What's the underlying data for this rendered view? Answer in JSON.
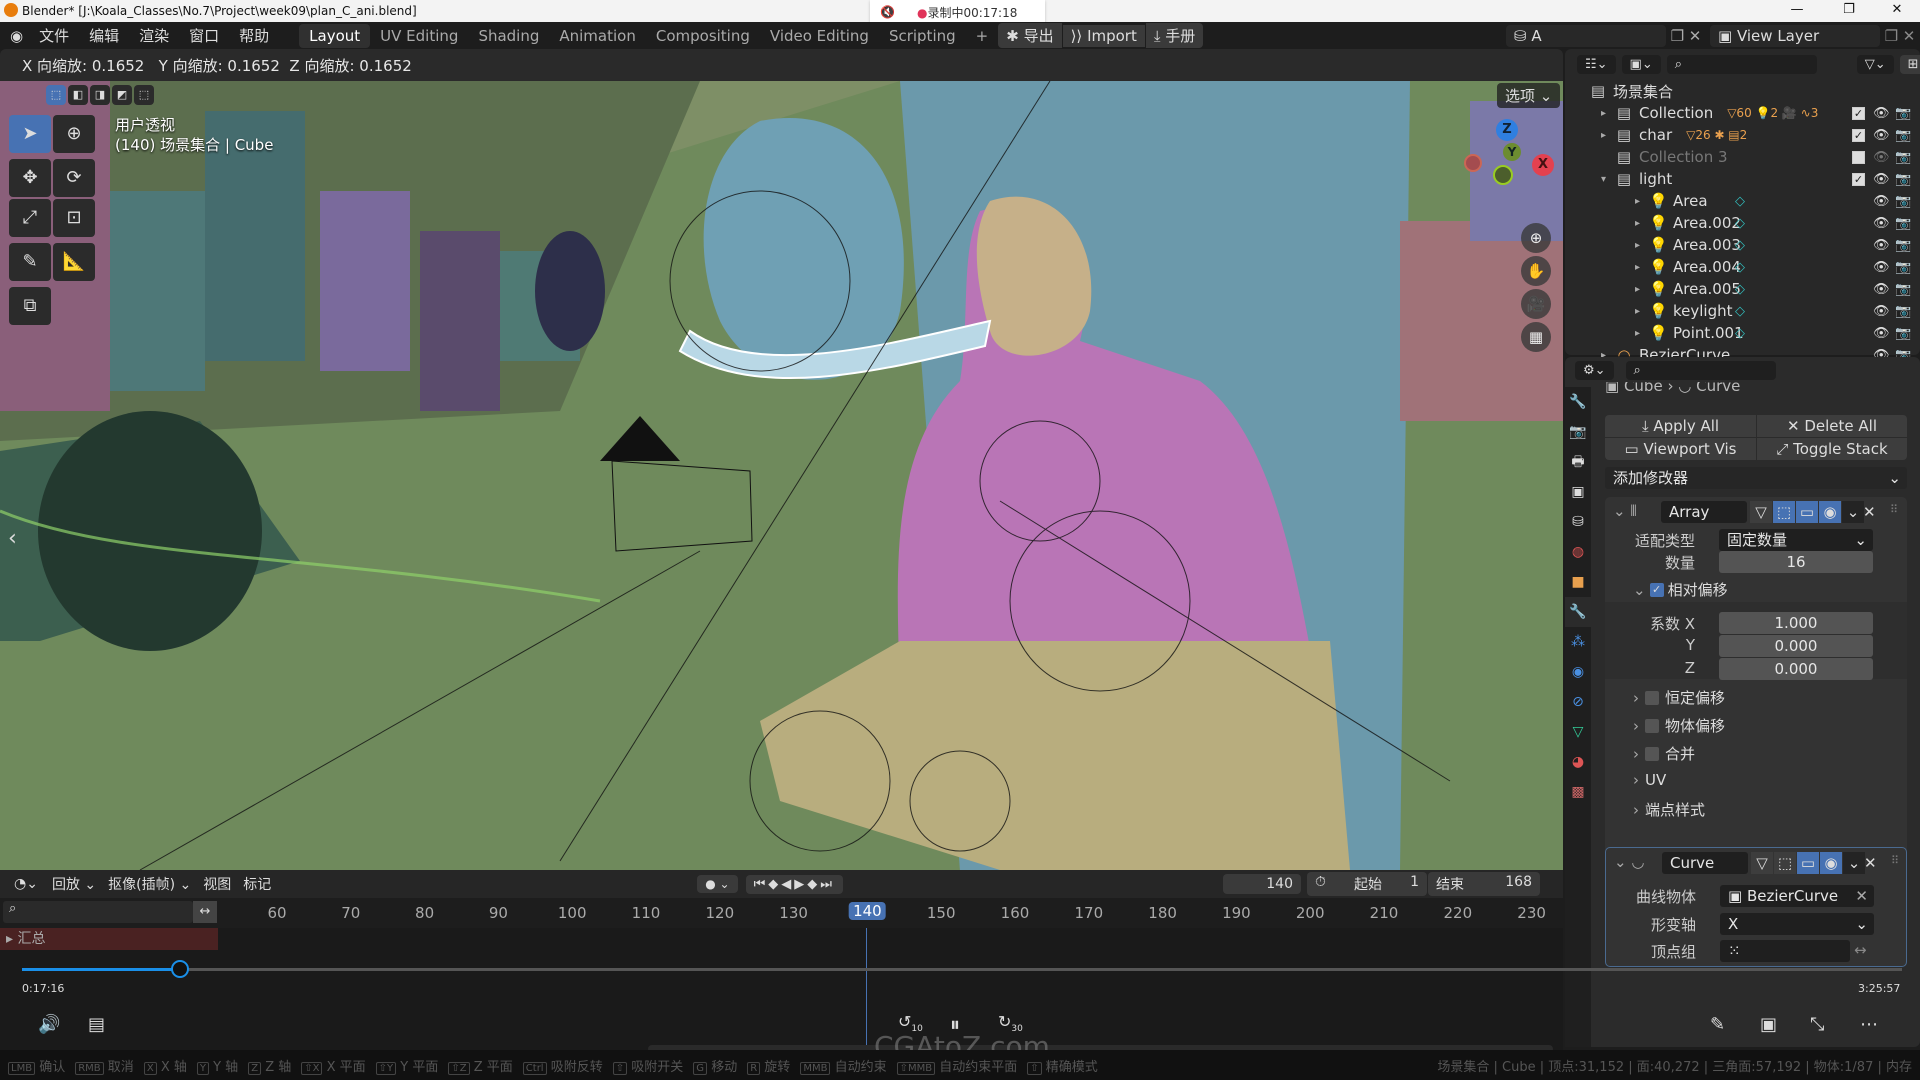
{
  "window": {
    "title": "Blender* [J:\\Koala_Classes\\No.7\\Project\\week09\\plan_C_ani.blend]",
    "recording": "录制中00:17:18",
    "controls": [
      "—",
      "❐",
      "✕"
    ]
  },
  "menu": {
    "items": [
      "文件",
      "编辑",
      "渲染",
      "窗口",
      "帮助"
    ],
    "workspaces": [
      "Layout",
      "UV Editing",
      "Shading",
      "Animation",
      "Compositing",
      "Video Editing",
      "Scripting"
    ],
    "add": "+",
    "addons": [
      "导出",
      "Import",
      "手册"
    ],
    "scene": "A",
    "view_layer": "View Layer"
  },
  "viewport": {
    "header_text": "X 向缩放: 0.1652   Y 向缩放: 0.1652  Z 向缩放: 0.1652",
    "view_name": "用户透视",
    "object_info": "(140) 场景集合 | Cube",
    "options": "选项",
    "gizmo": {
      "x": "X",
      "y": "Y",
      "z": "Z"
    }
  },
  "outliner": {
    "root": "场景集合",
    "rows": [
      {
        "name": "Collection",
        "badges": "▽60 💡2 🎥 ∿3",
        "checked": true,
        "level": 0,
        "type": "collection"
      },
      {
        "name": "char",
        "badges": "▽26 ✱ ▤2",
        "checked": true,
        "level": 0,
        "type": "collection"
      },
      {
        "name": "Collection 3",
        "badges": "",
        "checked": false,
        "level": 0,
        "type": "collection",
        "disabled": true
      },
      {
        "name": "light",
        "badges": "",
        "checked": true,
        "level": 0,
        "type": "collection",
        "expanded": true
      },
      {
        "name": "Area",
        "level": 1,
        "type": "light"
      },
      {
        "name": "Area.002",
        "level": 1,
        "type": "light"
      },
      {
        "name": "Area.003",
        "level": 1,
        "type": "light"
      },
      {
        "name": "Area.004",
        "level": 1,
        "type": "light"
      },
      {
        "name": "Area.005",
        "level": 1,
        "type": "light"
      },
      {
        "name": "keylight",
        "level": 1,
        "type": "light"
      },
      {
        "name": "Point.001",
        "level": 1,
        "type": "light"
      },
      {
        "name": "BezierCurve",
        "level": 0,
        "type": "curve"
      }
    ]
  },
  "properties": {
    "breadcrumb": [
      "Cube",
      "Curve"
    ],
    "apply_all": "Apply All",
    "delete_all": "Delete All",
    "viewport_vis": "Viewport Vis",
    "toggle_stack": "Toggle Stack",
    "add_modifier": "添加修改器",
    "array": {
      "name": "Array",
      "fit_type_label": "适配类型",
      "fit_type": "固定数量",
      "count_label": "数量",
      "count": "16",
      "relative_offset": "相对偏移",
      "factor_x_label": "系数 X",
      "factor_x": "1.000",
      "y_label": "Y",
      "y": "0.000",
      "z_label": "Z",
      "z": "0.000",
      "subpanels": [
        "恒定偏移",
        "物体偏移",
        "合并",
        "UV",
        "端点样式"
      ]
    },
    "curve": {
      "name": "Curve",
      "curve_object_label": "曲线物体",
      "curve_object": "BezierCurve",
      "deform_axis_label": "形变轴",
      "deform_axis": "X",
      "vertex_group_label": "顶点组"
    }
  },
  "timeline": {
    "menus": [
      "回放",
      "抠像(插帧)",
      "视图",
      "标记"
    ],
    "current_frame": "140",
    "start_label": "起始",
    "start": "1",
    "end_label": "结束",
    "end": "168",
    "ticks": [
      "60",
      "70",
      "80",
      "90",
      "100",
      "110",
      "120",
      "130",
      "140",
      "150",
      "160",
      "170",
      "180",
      "190",
      "200",
      "210",
      "220",
      "230"
    ],
    "summary": "汇总"
  },
  "player": {
    "elapsed": "0:17:16",
    "total": "3:25:57",
    "progress": 0.084,
    "rewind": "10",
    "forward": "30",
    "watermark": "CGAtoZ.com"
  },
  "status": {
    "hints": [
      [
        "LMB",
        "确认"
      ],
      [
        "RMB",
        "取消"
      ],
      [
        "X",
        "X 轴"
      ],
      [
        "Y",
        "Y 轴"
      ],
      [
        "Z",
        "Z 轴"
      ],
      [
        "⇧X",
        "X 平面"
      ],
      [
        "⇧Y",
        "Y 平面"
      ],
      [
        "⇧Z",
        "Z 平面"
      ],
      [
        "Ctrl",
        "吸附反转"
      ],
      [
        "⇧",
        "吸附开关"
      ],
      [
        "G",
        "移动"
      ],
      [
        "R",
        "旋转"
      ],
      [
        "MMB",
        "自动约束"
      ],
      [
        "⇧MMB",
        "自动约束平面"
      ],
      [
        "⇧",
        "精确模式"
      ]
    ],
    "stats": "场景集合 | Cube | 顶点:31,152 | 面:40,272 | 三角面:57,192 | 物体:1/87 | 内存"
  },
  "colors": {
    "accent": "#4772b3",
    "bg": "#1d1d1d",
    "panel": "#2b2b2b",
    "light_icon": "#e9a04e",
    "player_blue": "#1a8fe8"
  }
}
